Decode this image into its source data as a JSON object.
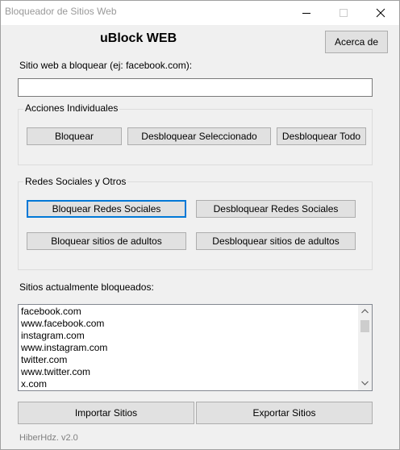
{
  "window": {
    "title": "Bloqueador de Sitios Web"
  },
  "header": {
    "app_title": "uBlock WEB",
    "about_label": "Acerca de"
  },
  "site_input": {
    "label": "Sitio web a bloquear (ej: facebook.com):",
    "value": "",
    "placeholder": ""
  },
  "individual_actions": {
    "legend": "Acciones Individuales",
    "block_label": "Bloquear",
    "unblock_selected_label": "Desbloquear Seleccionado",
    "unblock_all_label": "Desbloquear Todo"
  },
  "social": {
    "legend": "Redes Sociales y Otros",
    "block_social_label": "Bloquear Redes Sociales",
    "unblock_social_label": "Desbloquear Redes Sociales",
    "block_adult_label": "Bloquear sitios de adultos",
    "unblock_adult_label": "Desbloquear sitios de adultos"
  },
  "blocked_list": {
    "label": "Sitios actualmente bloqueados:",
    "items": [
      "facebook.com",
      "www.facebook.com",
      "instagram.com",
      "www.instagram.com",
      "twitter.com",
      "www.twitter.com",
      "x.com"
    ]
  },
  "bottom_actions": {
    "import_label": "Importar Sitios",
    "export_label": "Exportar Sitios"
  },
  "footer": {
    "version": "HiberHdz. v2.0"
  },
  "colors": {
    "focus_border": "#0078d7",
    "button_face": "#e1e1e1",
    "window_bg": "#f0f0f0"
  }
}
